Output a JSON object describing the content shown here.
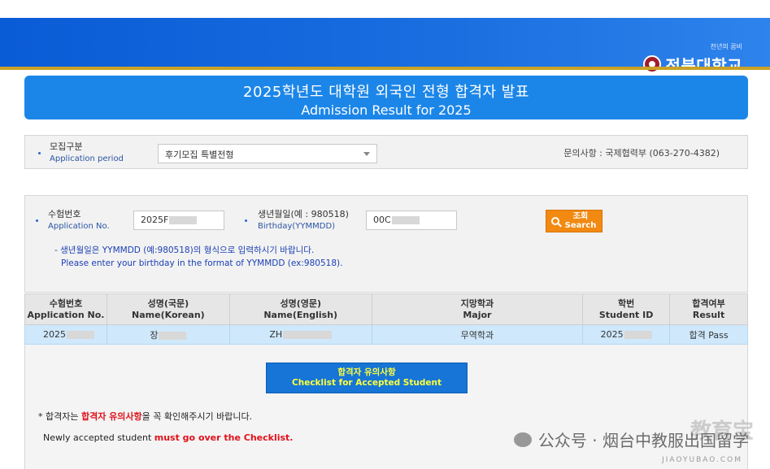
{
  "header": {
    "tagline": "천년의 꿈비",
    "university": "전북대학교"
  },
  "banner": {
    "title_ko": "2025학년도 대학원 외국인 전형 합격자 발표",
    "title_en": "Admission Result for 2025"
  },
  "period": {
    "label_ko": "모집구분",
    "label_en": "Application period",
    "selected": "후기모집 특별전형",
    "contact": "문의사항 : 국제협력부 (063-270-4382)"
  },
  "search": {
    "app_label_ko": "수험번호",
    "app_label_en": "Application No.",
    "app_value": "2025F",
    "birth_label_ko": "생년월일(예 : 980518)",
    "birth_label_en": "Birthday(YYMMDD)",
    "birth_value": "00C",
    "button_ko": "조회",
    "button_en": "Search",
    "note_ko": "- 생년월일은 YYMMDD (예:980518)의 형식으로 입력하시기 바랍니다.",
    "note_en": "Please enter your birthday in the format of YYMMDD (ex:980518)."
  },
  "table": {
    "headers": [
      {
        "ko": "수험번호",
        "en": "Application No."
      },
      {
        "ko": "성명(국문)",
        "en": "Name(Korean)"
      },
      {
        "ko": "성명(영문)",
        "en": "Name(English)"
      },
      {
        "ko": "지망학과",
        "en": "Major"
      },
      {
        "ko": "학번",
        "en": "Student ID"
      },
      {
        "ko": "합격여부",
        "en": "Result"
      }
    ],
    "row": {
      "app_no": "2025",
      "name_ko": "장",
      "name_en": "ZH",
      "major": "무역학과",
      "student_id": "2025",
      "result": "합격 Pass"
    }
  },
  "checklist": {
    "label_ko": "합격자 유의사항",
    "label_en": "Checklist for Accepted Student"
  },
  "footer": {
    "ko_prefix": "* 합격자는 ",
    "ko_highlight": "합격자 유의사항",
    "ko_suffix": "을 꼭 확인해주시기 바랍니다.",
    "en_prefix": "Newly accepted student ",
    "en_highlight": "must go over the Checklist."
  },
  "watermark": {
    "text": "公众号 · 烟台中教服出国留学",
    "brand": "教育宝",
    "brand_sub": "JIAOYUBAO.COM"
  }
}
